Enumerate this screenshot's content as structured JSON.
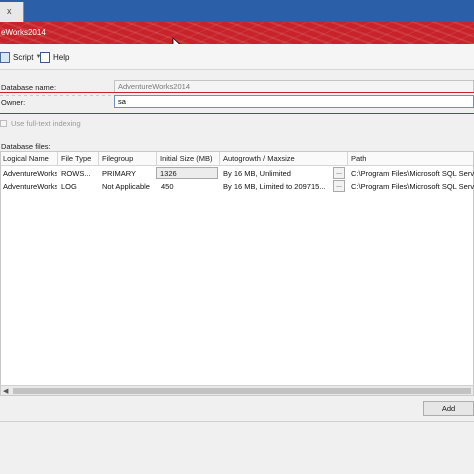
{
  "window": {
    "tab_close": "x",
    "title": "eWorks2014"
  },
  "toolbar": {
    "script_label": "Script",
    "help_label": "Help"
  },
  "form": {
    "database_name_label": "Database name:",
    "database_name_value": "AdventureWorks2014",
    "owner_label": "Owner:",
    "owner_value": "sa",
    "fulltext_label": "Use full-text indexing",
    "fulltext_checked": false,
    "database_files_label": "Database files:"
  },
  "grid": {
    "columns": [
      "Logical Name",
      "File Type",
      "Filegroup",
      "Initial Size (MB)",
      "Autogrowth / Maxsize",
      "Path"
    ],
    "rows": [
      {
        "logical_name": "AdventureWorks",
        "file_type": "ROWS...",
        "filegroup": "PRIMARY",
        "initial_size": "1326",
        "autogrowth": "By 16 MB, Unlimited",
        "ellipsis": "...",
        "path": "C:\\Program Files\\Microsoft SQL Serve"
      },
      {
        "logical_name": "AdventureWorks",
        "file_type": "LOG",
        "filegroup": "Not Applicable",
        "initial_size": "450",
        "autogrowth": "By 16 MB, Limited to 209715...",
        "ellipsis": "...",
        "path": "C:\\Program Files\\Microsoft SQL Serve"
      }
    ]
  },
  "buttons": {
    "add_label": "Add"
  },
  "colors": {
    "accent_red": "#c8232a",
    "tab_blue": "#2b5fa8"
  }
}
